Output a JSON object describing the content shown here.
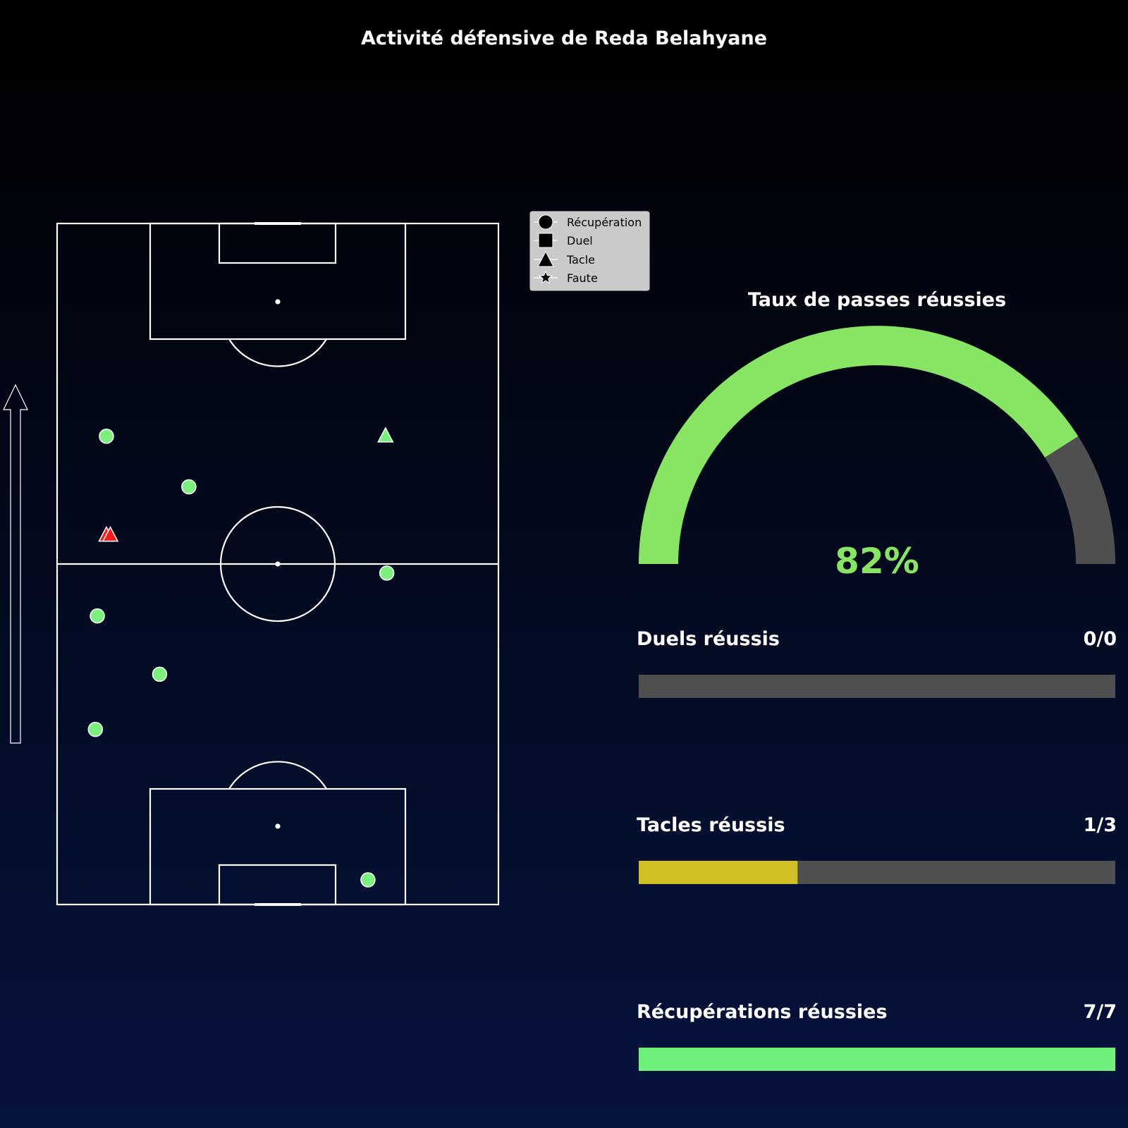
{
  "title": "Activité défensive de Reda Belahyane",
  "colors": {
    "success": "#7cf07c",
    "fail": "#ff1a1a",
    "gauge_fill": "#88e563",
    "track": "#4f4f4f",
    "tackles_fill": "#d0c026",
    "recoveries_fill": "#6ef07a"
  },
  "legend": [
    {
      "label": "Récupération",
      "marker": "circle"
    },
    {
      "label": "Duel",
      "marker": "square"
    },
    {
      "label": "Tacle",
      "marker": "triangle"
    },
    {
      "label": "Faute",
      "marker": "star"
    }
  ],
  "gauge": {
    "title": "Taux de passes réussies",
    "value": 82,
    "value_label": "82%"
  },
  "stats": [
    {
      "label": "Duels réussis",
      "value_text": "0/0",
      "success": 0,
      "total": 0,
      "color_key": "fail"
    },
    {
      "label": "Tacles réussis",
      "value_text": "1/3",
      "success": 1,
      "total": 3,
      "color_key": "tackles_fill"
    },
    {
      "label": "Récupérations réussies",
      "value_text": "7/7",
      "success": 7,
      "total": 7,
      "color_key": "recoveries_fill"
    }
  ],
  "chart_data": {
    "type": "scatter",
    "title": "Activité défensive de Reda Belahyane",
    "xlim": [
      0,
      68
    ],
    "ylim": [
      0,
      105
    ],
    "attack_direction": "up",
    "legend_position": "top-right",
    "points": [
      {
        "x": 7.6,
        "y": 72.2,
        "type": "Récupération",
        "success": true
      },
      {
        "x": 20.3,
        "y": 64.4,
        "type": "Récupération",
        "success": true
      },
      {
        "x": 50.6,
        "y": 72.3,
        "type": "Tacle",
        "success": true
      },
      {
        "x": 7.6,
        "y": 57.0,
        "type": "Tacle",
        "success": false
      },
      {
        "x": 8.2,
        "y": 57.0,
        "type": "Tacle",
        "success": false
      },
      {
        "x": 50.8,
        "y": 51.1,
        "type": "Récupération",
        "success": true
      },
      {
        "x": 6.2,
        "y": 44.5,
        "type": "Récupération",
        "success": true
      },
      {
        "x": 15.8,
        "y": 35.5,
        "type": "Récupération",
        "success": true
      },
      {
        "x": 5.9,
        "y": 27.0,
        "type": "Récupération",
        "success": true
      },
      {
        "x": 47.9,
        "y": 3.8,
        "type": "Récupération",
        "success": true
      }
    ]
  }
}
